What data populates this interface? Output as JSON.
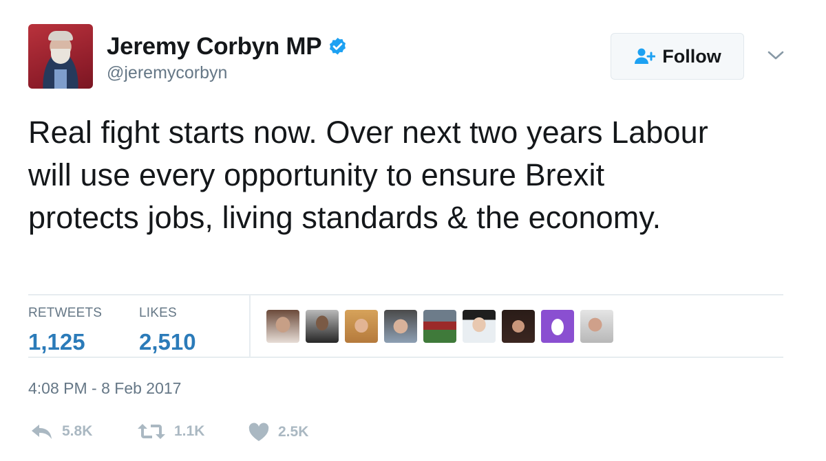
{
  "tweet": {
    "author_name": "Jeremy Corbyn MP",
    "handle": "@jeremycorbyn",
    "verified": true,
    "follow_label": "Follow",
    "text": "Real fight starts now. Over next two years Labour will use every opportunity to ensure Brexit protects jobs, living standards & the economy.",
    "timestamp": "4:08 PM - 8 Feb 2017"
  },
  "stats": {
    "retweets_label": "RETWEETS",
    "retweets_value": "1,125",
    "likes_label": "LIKES",
    "likes_value": "2,510"
  },
  "likers": [
    {
      "icon": "liker-avatar"
    },
    {
      "icon": "liker-avatar"
    },
    {
      "icon": "liker-avatar"
    },
    {
      "icon": "liker-avatar"
    },
    {
      "icon": "liker-avatar"
    },
    {
      "icon": "liker-avatar"
    },
    {
      "icon": "liker-avatar"
    },
    {
      "icon": "egg-avatar"
    },
    {
      "icon": "liker-avatar"
    }
  ],
  "actions": {
    "reply_count": "5.8K",
    "retweet_count": "1.1K",
    "like_count": "2.5K"
  },
  "colors": {
    "accent": "#2b7bb9",
    "verified": "#1da1f2",
    "muted": "#657786",
    "action_icon": "#aab8c2"
  }
}
